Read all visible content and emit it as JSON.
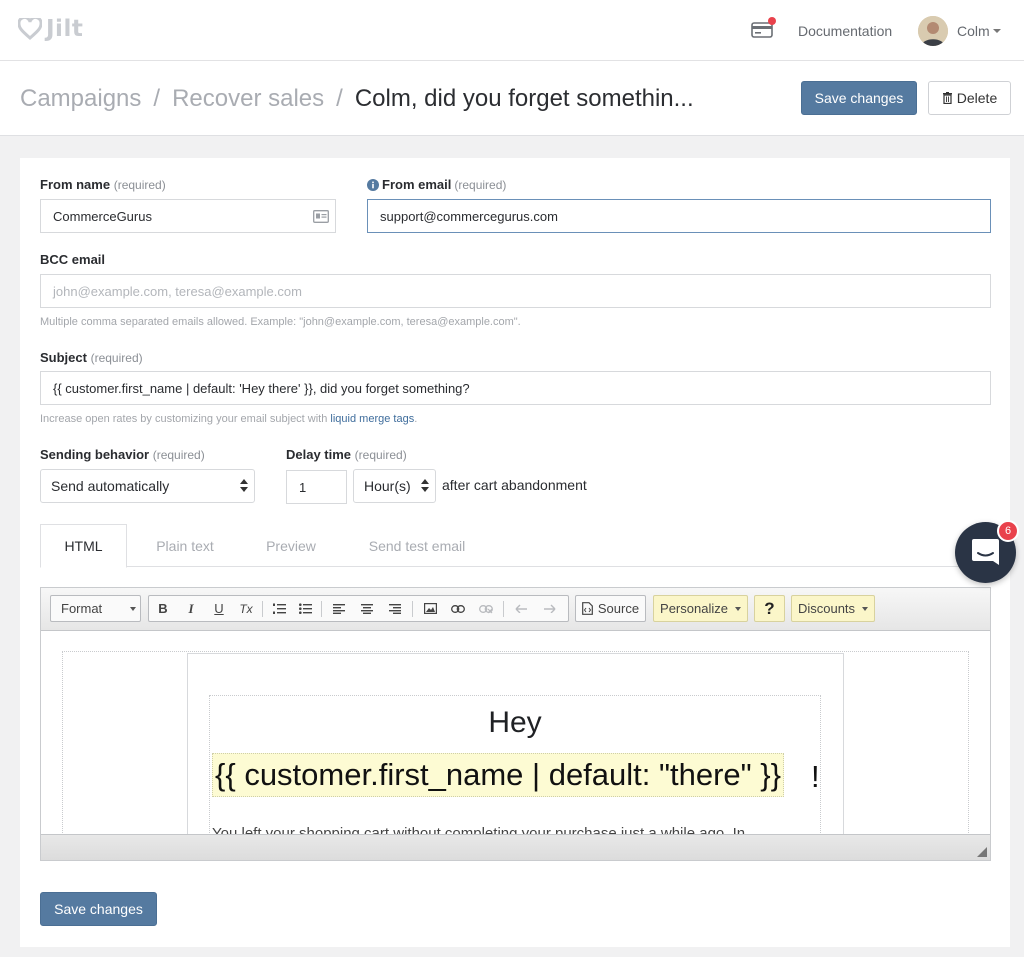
{
  "nav": {
    "logo_text": "Jilt",
    "documentation_label": "Documentation",
    "user_name": "Colm"
  },
  "header": {
    "breadcrumbs": [
      "Campaigns",
      "Recover sales"
    ],
    "separator": "/",
    "current_title": "Colm, did you forget somethin...",
    "save_label": "Save changes",
    "delete_label": "Delete"
  },
  "form": {
    "from_name": {
      "label": "From name",
      "required": "(required)",
      "value": "CommerceGurus"
    },
    "from_email": {
      "label": "From email",
      "required": "(required)",
      "value": "support@commercegurus.com"
    },
    "bcc_email": {
      "label": "BCC email",
      "placeholder": "john@example.com, teresa@example.com",
      "help": "Multiple comma separated emails allowed. Example: \"john@example.com, teresa@example.com\"."
    },
    "subject": {
      "label": "Subject",
      "required": "(required)",
      "value": "{{ customer.first_name | default: 'Hey there' }}, did you forget something?",
      "help_prefix": "Increase open rates by customizing your email subject with",
      "help_link": "liquid merge tags",
      "help_suffix": "."
    },
    "sending_behavior": {
      "label": "Sending behavior",
      "required": "(required)",
      "value": "Send automatically"
    },
    "delay_time": {
      "label": "Delay time",
      "required": "(required)",
      "value": "1",
      "unit": "Hour(s)",
      "suffix": "after cart abandonment"
    }
  },
  "tabs": [
    {
      "label": "HTML",
      "active": true
    },
    {
      "label": "Plain text",
      "active": false
    },
    {
      "label": "Preview",
      "active": false
    },
    {
      "label": "Send test email",
      "active": false
    }
  ],
  "editor": {
    "toolbar": {
      "format_label": "Format",
      "bold": "B",
      "italic": "I",
      "underline": "U",
      "clear_format": "Tx",
      "source_label": "Source",
      "personalize_label": "Personalize",
      "help_label": "?",
      "discounts_label": "Discounts"
    },
    "content": {
      "greeting": "Hey",
      "merge_tag": "{{ customer.first_name | default: \"there\" }}",
      "punctuation": "!",
      "body_preview": "You left your shopping cart without completing your purchase just a while ago. In"
    }
  },
  "footer": {
    "save_label": "Save changes"
  },
  "chat": {
    "badge_count": "6"
  },
  "colors": {
    "primary": "#557aa0",
    "badge": "#e9424c",
    "chat_bg": "#2a3445",
    "merge_highlight": "#fdfbd3"
  }
}
